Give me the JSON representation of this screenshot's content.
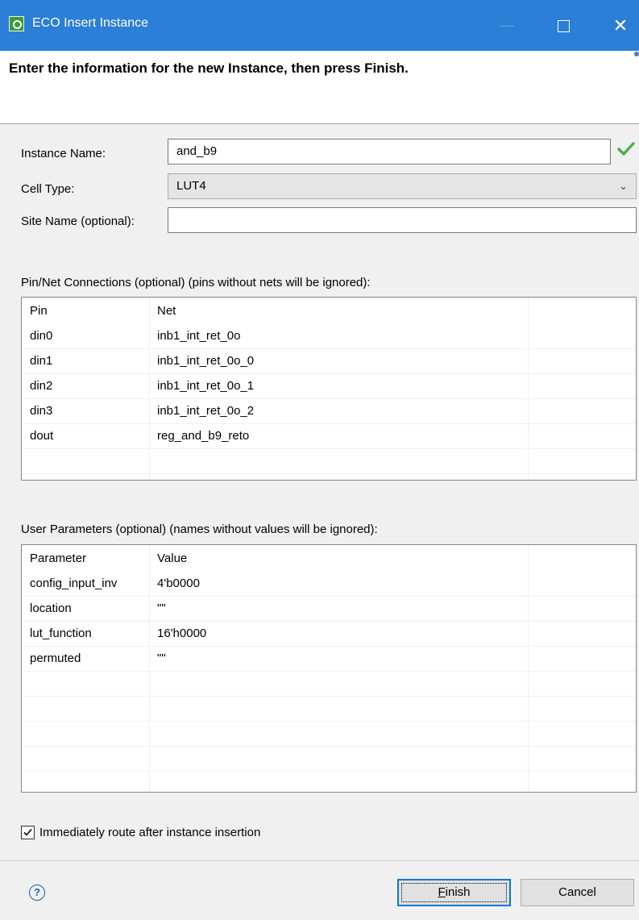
{
  "window": {
    "title": "ECO Insert Instance"
  },
  "header": {
    "instruction": "Enter the information for the new Instance, then press Finish."
  },
  "form": {
    "instance_name_label": "Instance Name:",
    "instance_name_value": "and_b9",
    "cell_type_label": "Cell Type:",
    "cell_type_value": "LUT4",
    "site_name_label": "Site Name (optional):",
    "site_name_value": ""
  },
  "pins": {
    "section_label": "Pin/Net Connections (optional) (pins without nets will be ignored):",
    "columns": [
      "Pin",
      "Net",
      ""
    ],
    "rows": [
      {
        "pin": "din0",
        "net": "inb1_int_ret_0o"
      },
      {
        "pin": "din1",
        "net": "inb1_int_ret_0o_0"
      },
      {
        "pin": "din2",
        "net": "inb1_int_ret_0o_1"
      },
      {
        "pin": "din3",
        "net": "inb1_int_ret_0o_2"
      },
      {
        "pin": "dout",
        "net": "reg_and_b9_reto"
      }
    ]
  },
  "params": {
    "section_label": "User Parameters (optional) (names without values will be ignored):",
    "columns": [
      "Parameter",
      "Value",
      ""
    ],
    "rows": [
      {
        "name": "config_input_inv",
        "value": "4'b0000"
      },
      {
        "name": "location",
        "value": "\"\""
      },
      {
        "name": "lut_function",
        "value": "16'h0000"
      },
      {
        "name": "permuted",
        "value": "\"\""
      }
    ]
  },
  "options": {
    "route_after_label": "Immediately route after instance insertion",
    "route_after_checked": true
  },
  "footer": {
    "finish_mnemonic": "F",
    "finish_rest": "inish",
    "cancel_label": "Cancel"
  },
  "colors": {
    "titlebar": "#2b7fd6",
    "accent": "#0078d7",
    "valid_check": "#4caf50"
  }
}
